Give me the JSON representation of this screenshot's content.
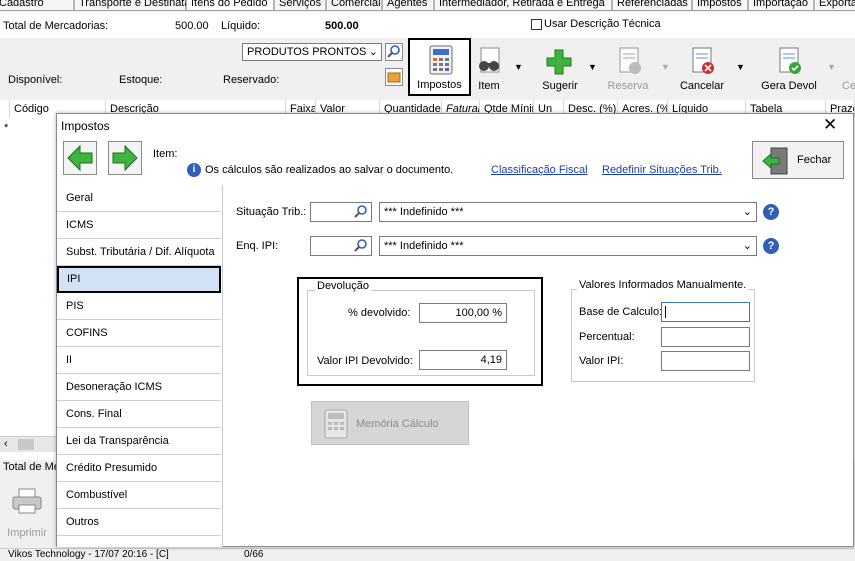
{
  "tabs": [
    "Cadastro",
    "Transporte e Destinatário",
    "Itens do Pedido",
    "Serviços",
    "Comercial",
    "Agentes",
    "Intermediador, Retirada e Entrega",
    "Referenciadas",
    "Impostos",
    "Importação",
    "Exporta"
  ],
  "summary": {
    "total_label": "Total de Mercadorias:",
    "total_value": "500.00",
    "liquido_label": "Líquido:",
    "liquido_value": "500.00",
    "usar_descricao_label": "Usar Descrição Técnica"
  },
  "product_combo": "PRODUTOS PRONTOS",
  "stock": {
    "disponivel": "Disponível:",
    "estoque": "Estoque:",
    "reservado": "Reservado:"
  },
  "toolbar": {
    "impostos": "Impostos",
    "item": "Item",
    "sugerir": "Sugerir",
    "reserva": "Reserva",
    "cancelar": "Cancelar",
    "gera_devol": "Gera Devol",
    "ce": "Ce"
  },
  "grid": {
    "columns": [
      "Código",
      "Descrição",
      "Faixa",
      "Valor",
      "Quantidade",
      "Faturar",
      "Qtde Mínima",
      "Un",
      "Desc. (%)",
      "Acres. (%)",
      "Líquido",
      "Tabela",
      "Prazo"
    ],
    "row_marker": "*"
  },
  "bottom": {
    "total_label": "Total de Me",
    "imprimir": "Imprimir",
    "status": "Vikos Technology - 17/07 20:16 - [C]",
    "count": "0/66"
  },
  "modal": {
    "title": "Impostos",
    "item_label": "Item:",
    "info_text": "Os cálculos são realizados ao salvar o documento.",
    "link_classificacao": "Classificação Fiscal",
    "link_redefinir": "Redefinir Situações Trib.",
    "fechar": "Fechar",
    "nav": [
      "Geral",
      "ICMS",
      "Subst. Tributária / Dif. Alíquota",
      "IPI",
      "PIS",
      "COFINS",
      "II",
      "Desoneração ICMS",
      "Cons. Final",
      "Lei da Transparência",
      "Crédito Presumido",
      "Combustível",
      "Outros"
    ],
    "selected_nav": "IPI",
    "situacao_label": "Situação Trib.:",
    "situacao_value": "*** Indefinido ***",
    "enq_label": "Enq. IPI:",
    "enq_value": "*** Indefinido ***",
    "devolucao": {
      "legend": "Devolução",
      "pct_label": "% devolvido:",
      "pct_value": "100,00 %",
      "valor_label": "Valor IPI Devolvido:",
      "valor_value": "4,19"
    },
    "manual": {
      "legend": "Valores Informados Manualmente.",
      "base_label": "Base de Calculo:",
      "base_value": "",
      "percentual_label": "Percentual:",
      "percentual_value": "",
      "valor_label": "Valor IPI:",
      "valor_value": ""
    },
    "memoria_button": "Memória Cálculo"
  }
}
